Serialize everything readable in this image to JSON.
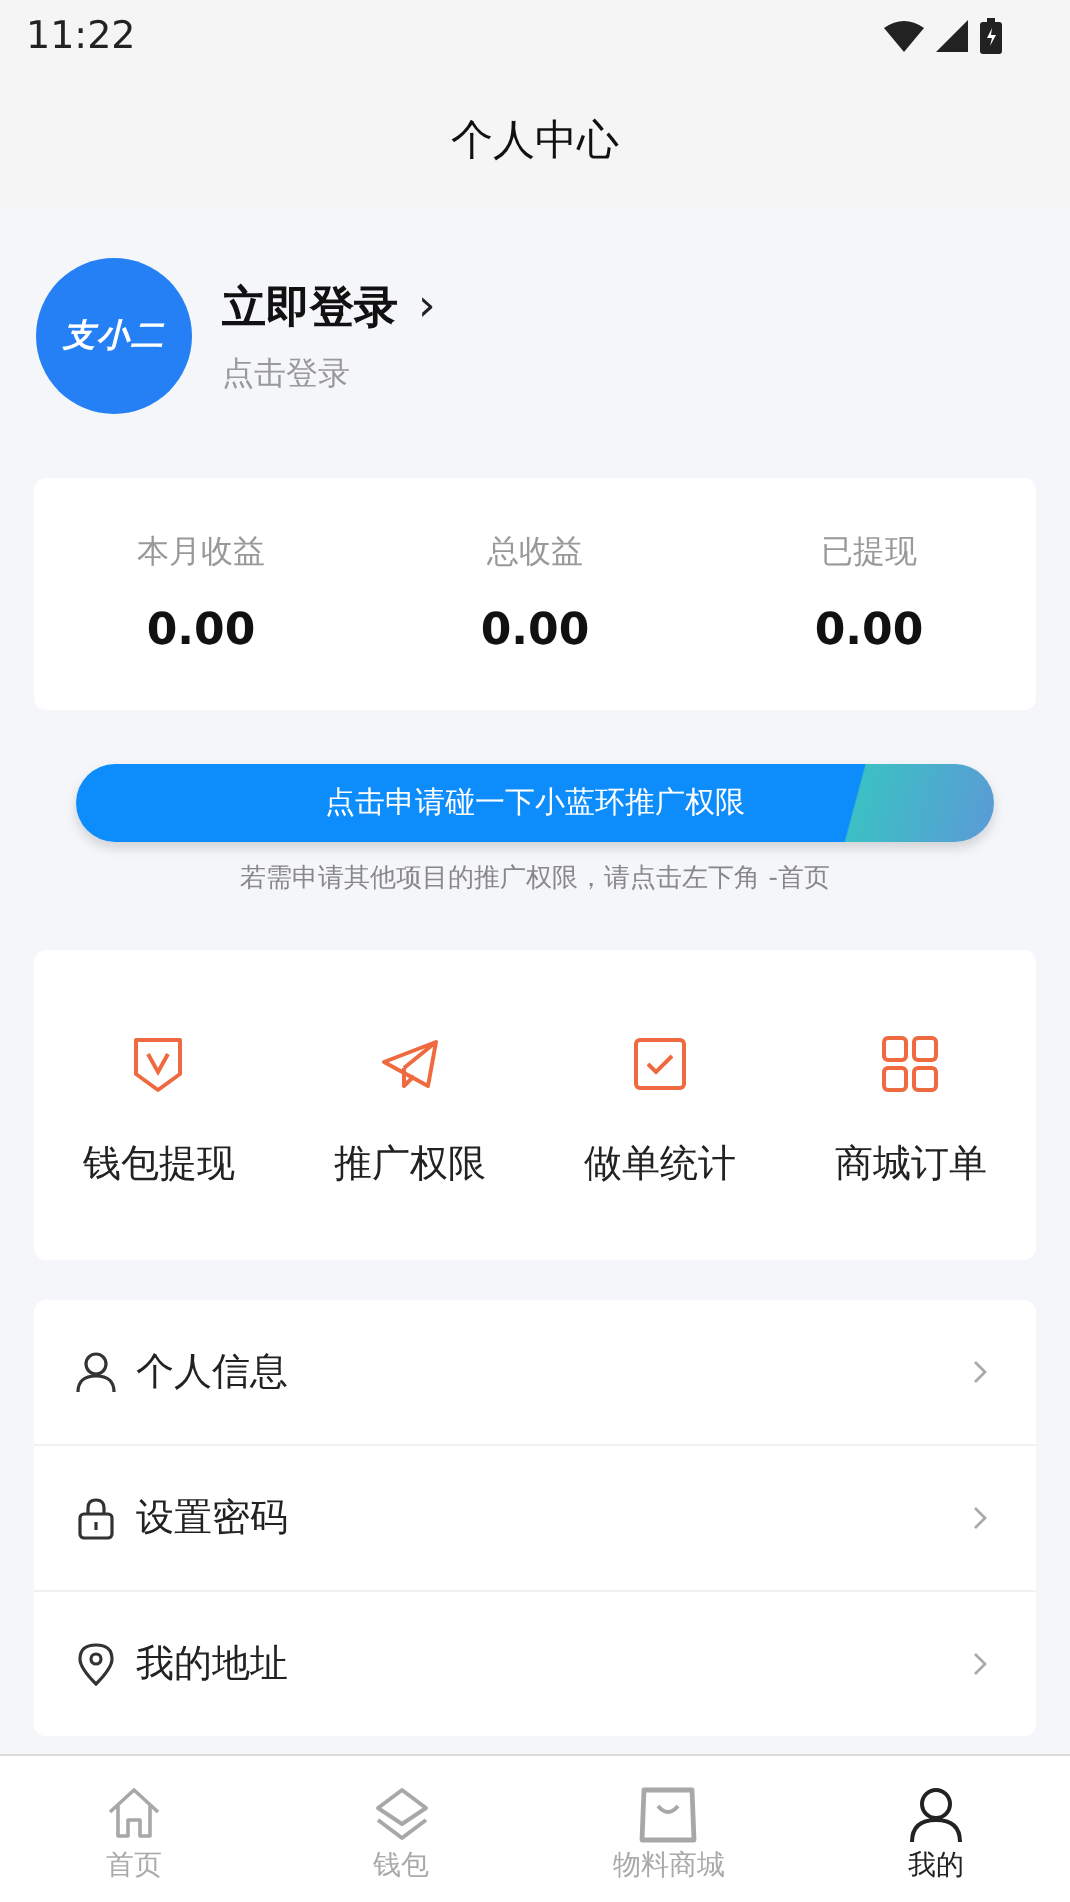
{
  "status_bar": {
    "time": "11:22"
  },
  "header": {
    "title": "个人中心"
  },
  "profile": {
    "avatar_text": "支小二",
    "name": "立即登录",
    "chevron": "›",
    "subtitle": "点击登录"
  },
  "stats": [
    {
      "label": "本月收益",
      "value": "0.00"
    },
    {
      "label": "总收益",
      "value": "0.00"
    },
    {
      "label": "已提现",
      "value": "0.00"
    }
  ],
  "banner": {
    "button": "点击申请碰一下小蓝环推广权限",
    "hint": "若需申请其他项目的推广权限，请点击左下角 -首页"
  },
  "shortcuts": [
    {
      "label": "钱包提现"
    },
    {
      "label": "推广权限"
    },
    {
      "label": "做单统计"
    },
    {
      "label": "商城订单"
    }
  ],
  "menu": [
    {
      "label": "个人信息"
    },
    {
      "label": "设置密码"
    },
    {
      "label": "我的地址"
    }
  ],
  "tab_bar": [
    {
      "label": "首页",
      "selected": false
    },
    {
      "label": "钱包",
      "selected": false
    },
    {
      "label": "物料商城",
      "selected": false
    },
    {
      "label": "我的",
      "selected": true
    }
  ]
}
